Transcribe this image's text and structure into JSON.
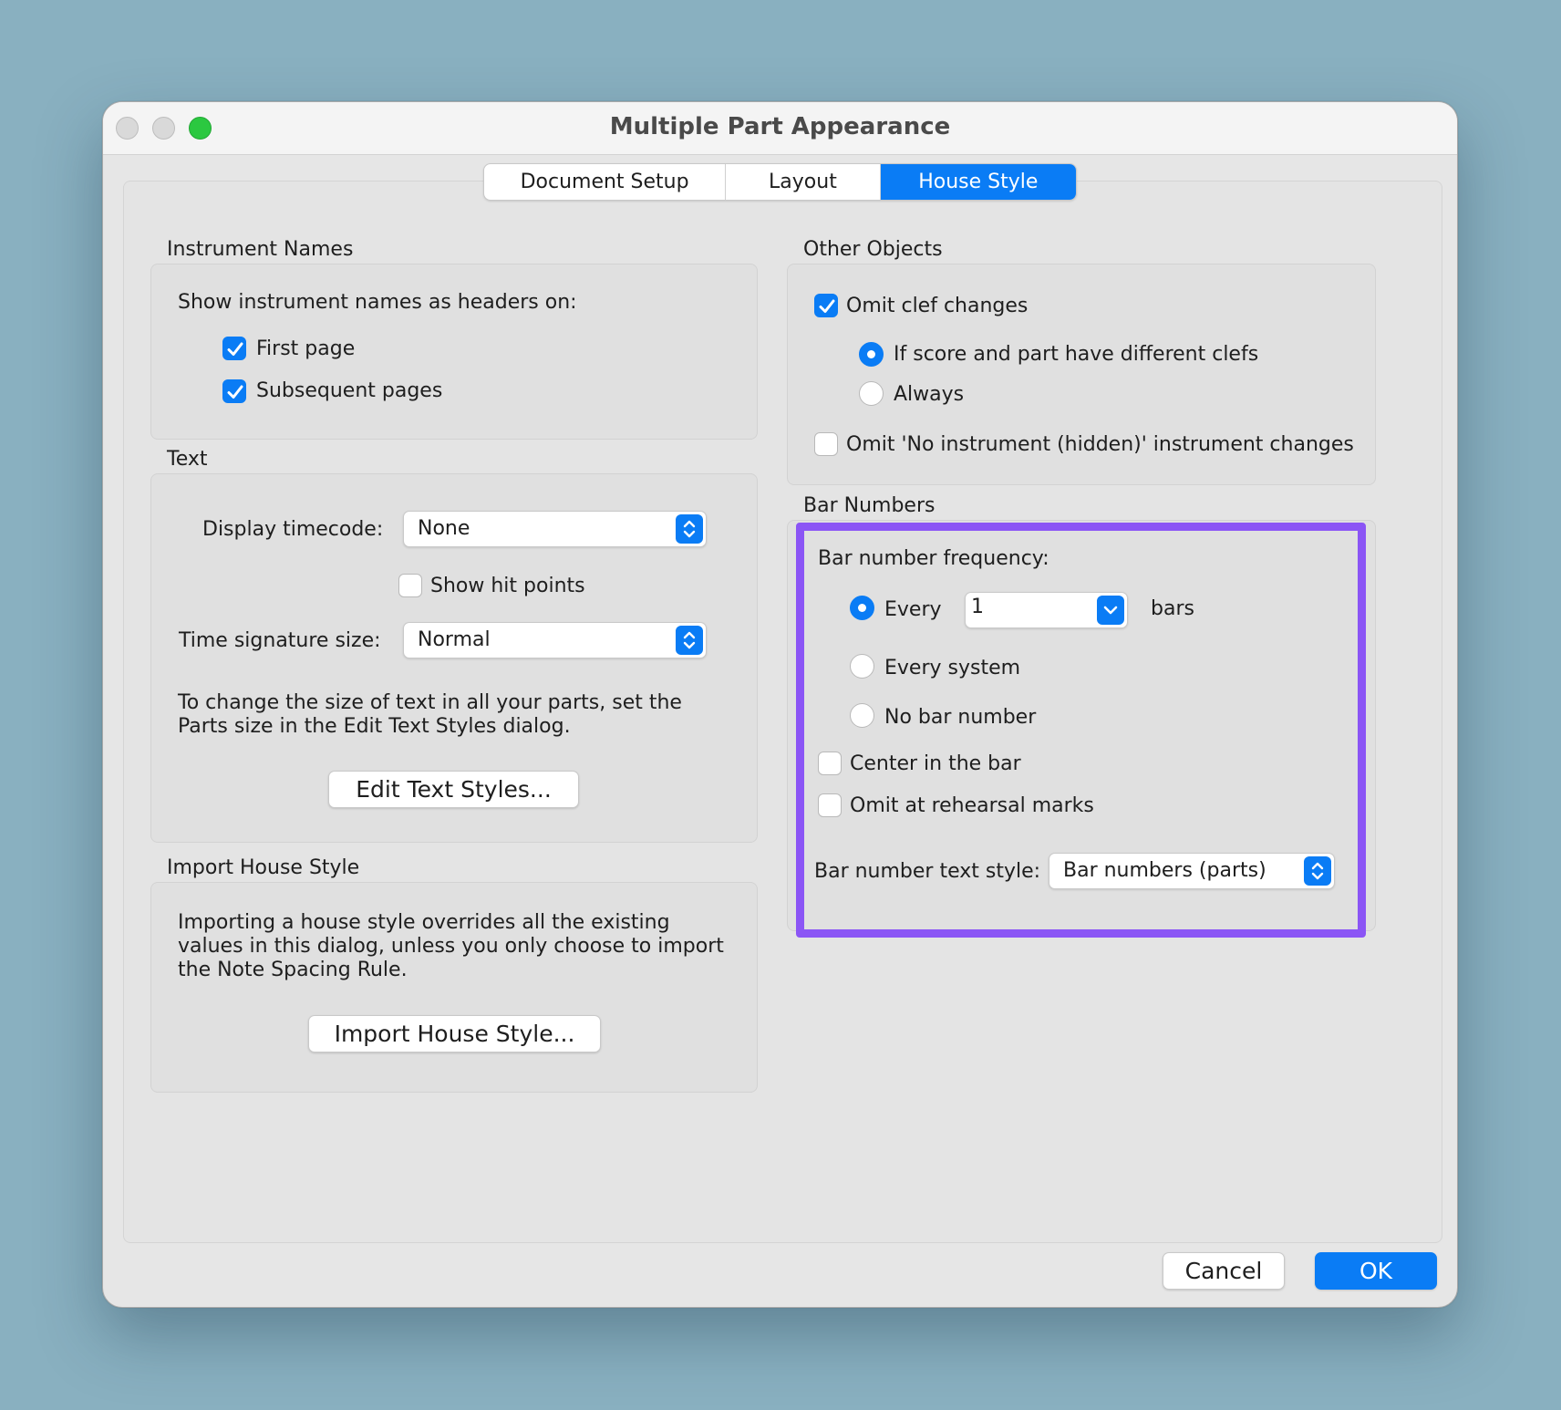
{
  "window": {
    "title": "Multiple Part Appearance"
  },
  "tabs": [
    {
      "label": "Document Setup",
      "active": false
    },
    {
      "label": "Layout",
      "active": false
    },
    {
      "label": "House Style",
      "active": true
    }
  ],
  "instrument_names": {
    "section_label": "Instrument Names",
    "prompt": "Show instrument names as headers on:",
    "first_page": {
      "label": "First page",
      "checked": true
    },
    "subsequent_pages": {
      "label": "Subsequent pages",
      "checked": true
    }
  },
  "text": {
    "section_label": "Text",
    "display_timecode": {
      "label": "Display timecode:",
      "value": "None"
    },
    "show_hit_points": {
      "label": "Show hit points",
      "checked": false
    },
    "time_signature_size": {
      "label": "Time signature size:",
      "value": "Normal"
    },
    "info": "To change the size of text in all your parts, set the Parts size in the Edit Text Styles dialog.",
    "edit_button": "Edit Text Styles..."
  },
  "import_house_style": {
    "section_label": "Import House Style",
    "info": "Importing a house style overrides all the existing values in this dialog, unless you only choose to import the Note Spacing Rule.",
    "button": "Import House Style..."
  },
  "other_objects": {
    "section_label": "Other Objects",
    "omit_clef_changes": {
      "label": "Omit clef changes",
      "checked": true
    },
    "if_different_clefs": {
      "label": "If score and part have different clefs",
      "selected": true
    },
    "always": {
      "label": "Always",
      "selected": false
    },
    "omit_no_instrument": {
      "label": "Omit 'No instrument (hidden)' instrument changes",
      "checked": false
    }
  },
  "bar_numbers": {
    "section_label": "Bar Numbers",
    "frequency_label": "Bar number frequency:",
    "every": {
      "label": "Every",
      "selected": true,
      "value": "1",
      "suffix": "bars"
    },
    "every_system": {
      "label": "Every system",
      "selected": false
    },
    "no_bar_number": {
      "label": "No bar number",
      "selected": false
    },
    "center_in_bar": {
      "label": "Center in the bar",
      "checked": false
    },
    "omit_at_rehearsal": {
      "label": "Omit at rehearsal marks",
      "checked": false
    },
    "text_style": {
      "label": "Bar number text style:",
      "value": "Bar numbers (parts)"
    },
    "highlight_color": "#8b55f5"
  },
  "footer": {
    "cancel": "Cancel",
    "ok": "OK"
  },
  "colors": {
    "accent": "#0a7cf5",
    "background": "#89b0c0"
  }
}
